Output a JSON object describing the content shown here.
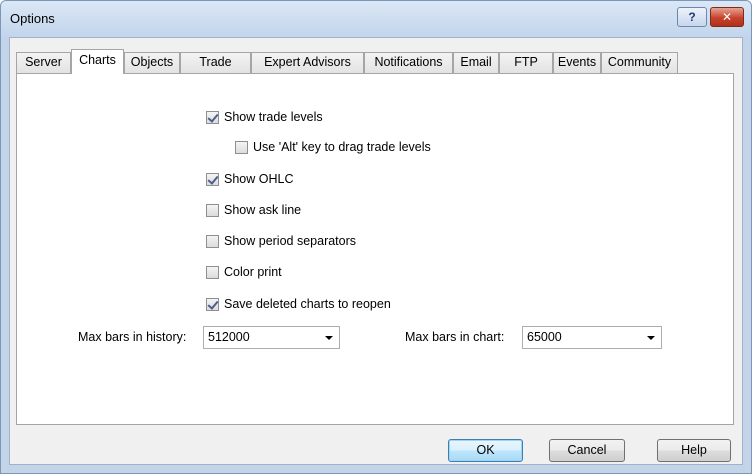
{
  "window": {
    "title": "Options",
    "help_glyph": "?",
    "close_glyph": "✕"
  },
  "tabs": [
    {
      "label": "Server"
    },
    {
      "label": "Charts",
      "active": true
    },
    {
      "label": "Objects"
    },
    {
      "label": "Trade"
    },
    {
      "label": "Expert Advisors"
    },
    {
      "label": "Notifications"
    },
    {
      "label": "Email"
    },
    {
      "label": "FTP"
    },
    {
      "label": "Events"
    },
    {
      "label": "Community"
    }
  ],
  "checkboxes": [
    {
      "label": "Show trade levels",
      "checked": true
    },
    {
      "label": "Use 'Alt' key to drag trade levels",
      "checked": false
    },
    {
      "label": "Show OHLC",
      "checked": true
    },
    {
      "label": "Show ask line",
      "checked": false
    },
    {
      "label": "Show period separators",
      "checked": false
    },
    {
      "label": "Color print",
      "checked": false
    },
    {
      "label": "Save deleted charts to reopen",
      "checked": true
    }
  ],
  "history": {
    "label": "Max bars in history:",
    "value": "512000"
  },
  "chart": {
    "label": "Max bars in chart:",
    "value": "65000"
  },
  "buttons": {
    "ok": "OK",
    "cancel": "Cancel",
    "help": "Help"
  }
}
